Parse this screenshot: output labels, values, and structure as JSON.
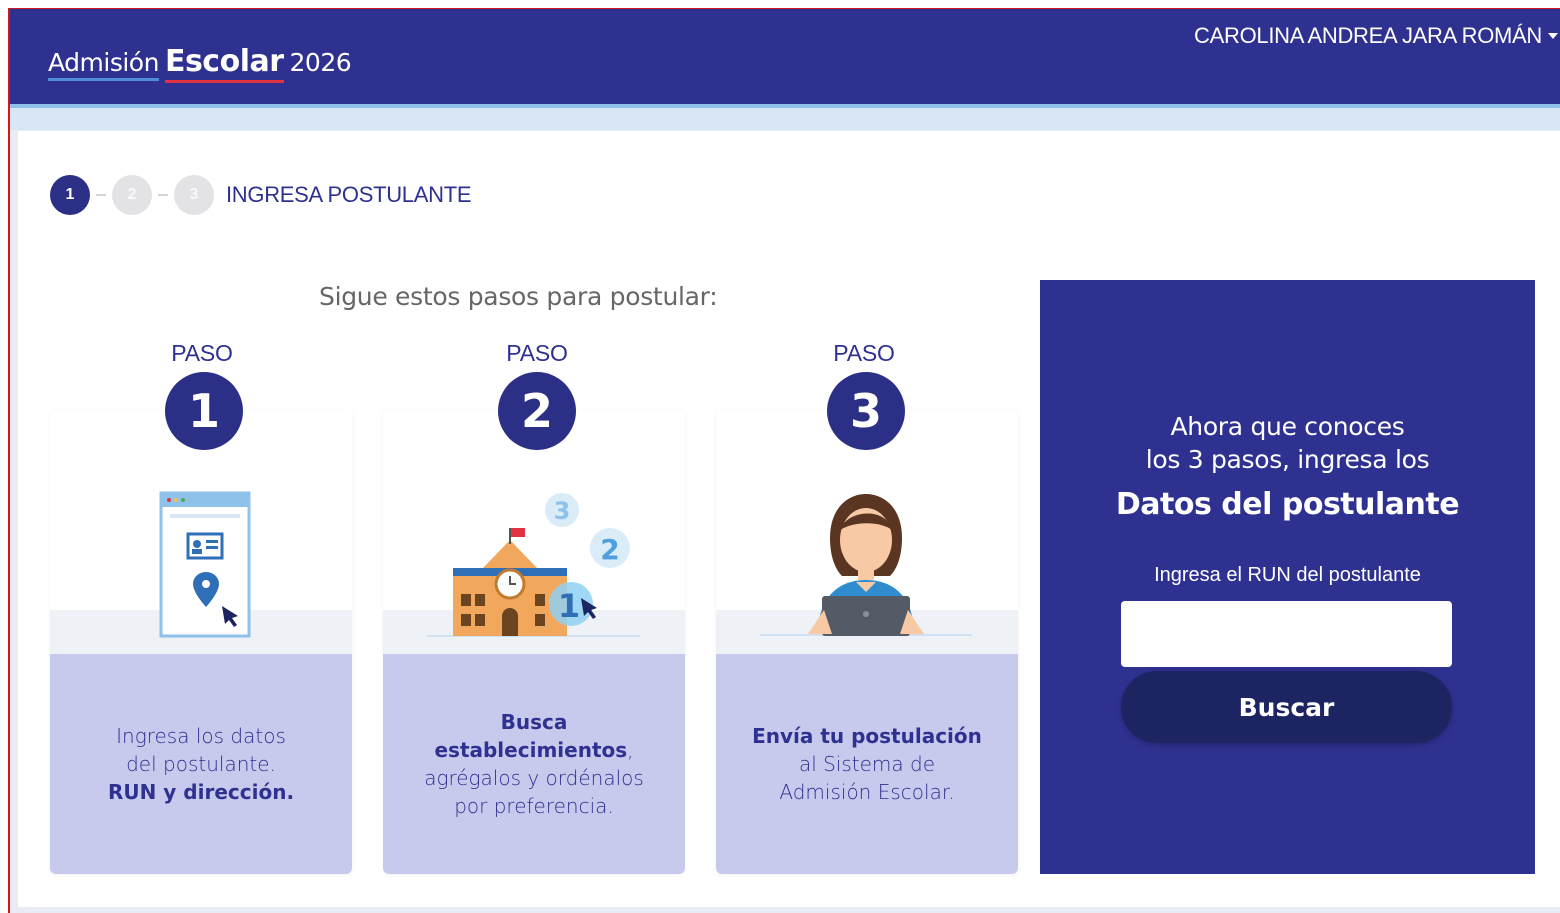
{
  "header": {
    "brand_part1": "Admisión",
    "brand_part2": "Escolar",
    "brand_year": "2026",
    "user_name": "CAROLINA ANDREA JARA ROMÁN"
  },
  "stepper": {
    "steps": [
      "1",
      "2",
      "3"
    ],
    "active_step": 1,
    "label": "INGRESA POSTULANTE"
  },
  "intro_title": "Sigue estos pasos para postular:",
  "steps": [
    {
      "paso_label": "PASO",
      "number": "1",
      "icon": "id-card-location-icon",
      "desc_line1": "Ingresa los datos",
      "desc_line2": "del postulante.",
      "desc_bold": "RUN y dirección."
    },
    {
      "paso_label": "PASO",
      "number": "2",
      "icon": "school-building-icon",
      "desc_bold": "Busca establecimientos",
      "desc_after_bold": ",",
      "desc_line2": "agrégalos y ordénalos",
      "desc_line3": "por preferencia."
    },
    {
      "paso_label": "PASO",
      "number": "3",
      "icon": "person-laptop-icon",
      "desc_bold": "Envía tu postulación",
      "desc_line2": "al Sistema de",
      "desc_line3": "Admisión Escolar."
    }
  ],
  "right_panel": {
    "intro_line1": "Ahora que conoces",
    "intro_line2": "los 3 pasos, ingresa los",
    "title": "Datos del postulante",
    "run_label": "Ingresa el RUN del postulante",
    "run_value": "",
    "search_button": "Buscar"
  },
  "colors": {
    "primary": "#2f3191",
    "dark_button": "#1c2561",
    "panel_lavender": "#c7c9ed",
    "accent_red": "#e23342",
    "accent_blue": "#4d8fd8"
  }
}
